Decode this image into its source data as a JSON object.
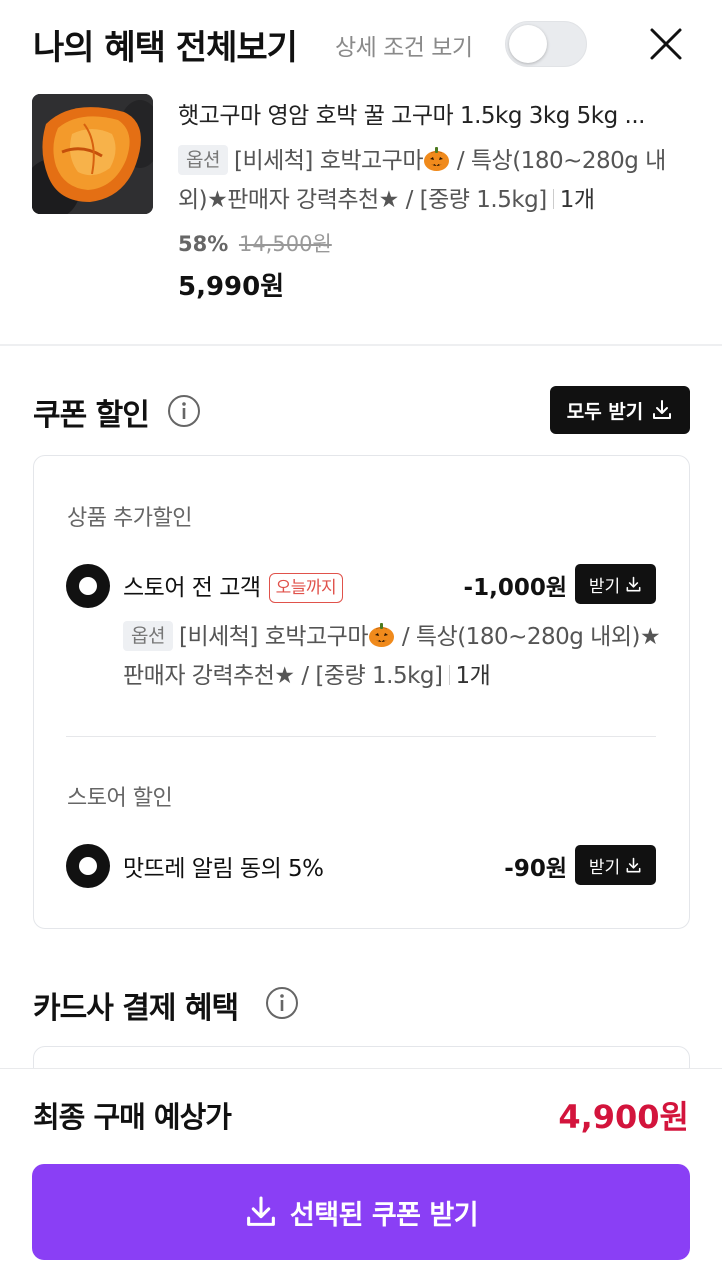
{
  "header": {
    "title": "나의 혜택 전체보기",
    "detail_toggle_label": "상세 조건 보기",
    "detail_toggle_on": false
  },
  "product": {
    "name": "햇고구마 영암 호박 꿀 고구마 1.5kg 3kg 5kg ...",
    "option_badge": "옵션",
    "option_text_1": "[비세척] 호박고구마",
    "option_text_2": " / 특상(180~280g 내외)★판매자 강력추천★ / [중량 1.5kg]",
    "quantity": "1개",
    "discount_rate": "58%",
    "original_price": "14,500원",
    "price": "5,990원"
  },
  "coupon_section": {
    "title": "쿠폰 할인",
    "download_all_label": "모두 받기",
    "groups": [
      {
        "label": "상품 추가할인",
        "coupon": {
          "name": "스토어 전 고객",
          "badge": "오늘까지",
          "amount": "-1,000원",
          "get_label": "받기",
          "selected": true,
          "option_badge": "옵션",
          "option_text_1": "[비세척] 호박고구마",
          "option_text_2": " / 특상(180~280g 내외)★판매자 강력추천★ / [중량 1.5kg]",
          "quantity": "1개"
        }
      },
      {
        "label": "스토어 할인",
        "coupon": {
          "name": "맛뜨레 알림 동의 5%",
          "amount": "-90원",
          "get_label": "받기",
          "selected": true
        }
      }
    ]
  },
  "card_section": {
    "title": "카드사 결제 혜택"
  },
  "footer": {
    "total_label": "최종 구매 예상가",
    "total_value": "4,900원",
    "main_button_label": "선택된 쿠폰 받기"
  },
  "colors": {
    "accent_purple": "#8a3ff5",
    "total_red": "#d3143c",
    "badge_red": "#e0524b"
  },
  "icons": [
    "close-icon",
    "info-icon",
    "download-icon",
    "pumpkin-icon"
  ]
}
